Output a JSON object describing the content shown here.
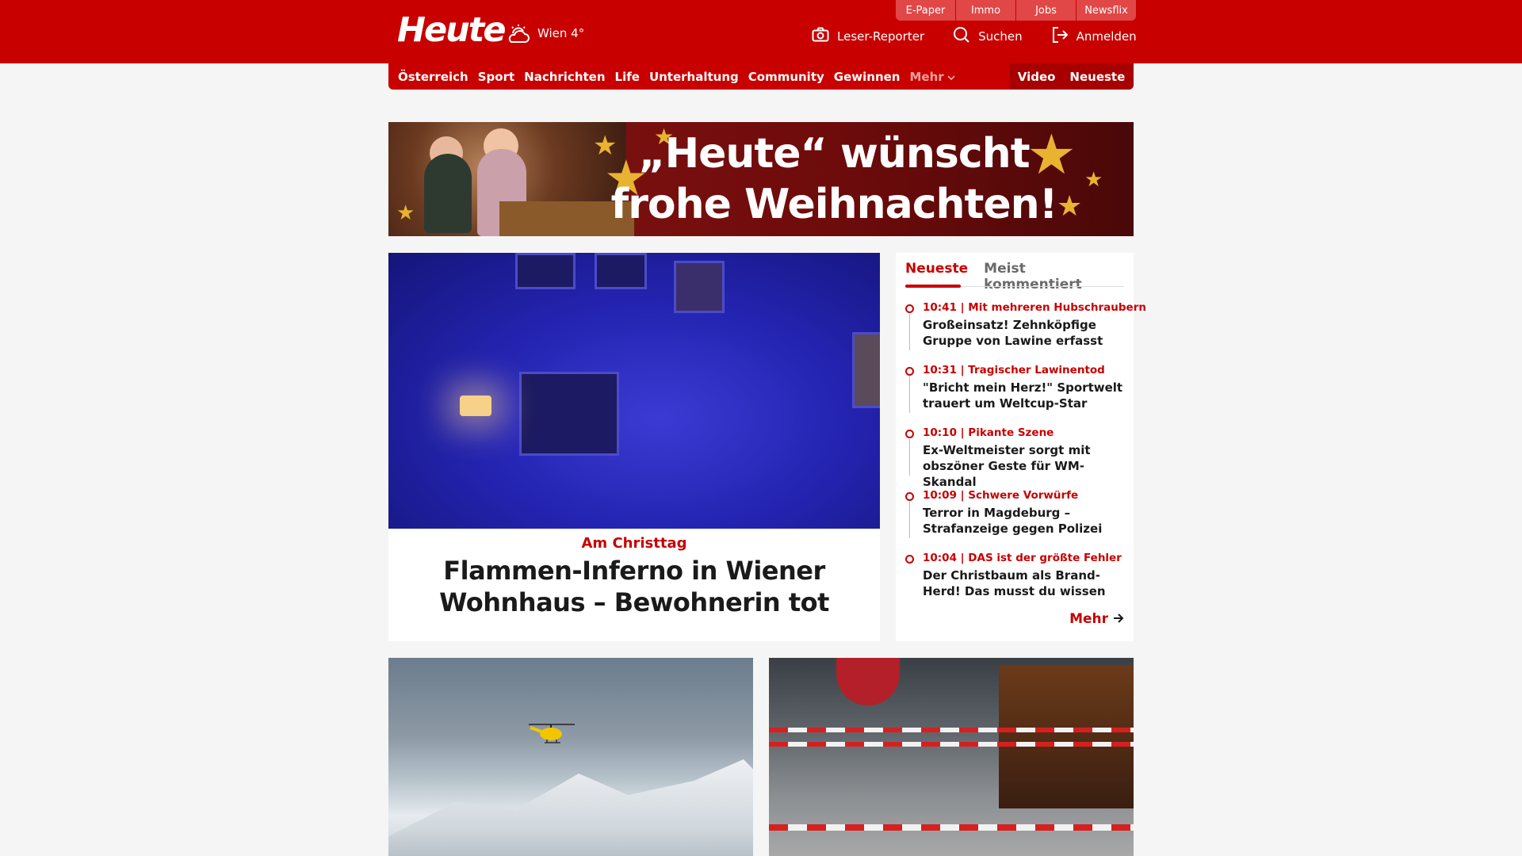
{
  "header": {
    "logo": "Heute",
    "weather": {
      "icon": "cloud-sun-icon",
      "text": "Wien 4°"
    },
    "services": [
      "E-Paper",
      "Immo",
      "Jobs",
      "Newsflix"
    ],
    "actions": [
      {
        "icon": "camera-icon",
        "label": "Leser-Reporter"
      },
      {
        "icon": "search-icon",
        "label": "Suchen"
      },
      {
        "icon": "login-icon",
        "label": "Anmelden"
      }
    ]
  },
  "nav": {
    "items": [
      "Österreich",
      "Sport",
      "Nachrichten",
      "Life",
      "Unterhaltung",
      "Community",
      "Gewinnen"
    ],
    "more": "Mehr",
    "right": [
      "Video",
      "Neueste"
    ]
  },
  "banner": {
    "line1": "„Heute“ wünscht",
    "line2": "frohe Weihnachten!"
  },
  "lead": {
    "kicker": "Am Christtag",
    "headline": "Flammen-Inferno in Wiener Wohnhaus – Bewohnerin tot"
  },
  "latest": {
    "tabs": [
      "Neueste",
      "Meist kommentiert"
    ],
    "items": [
      {
        "meta": "10:41 | Mit mehreren Hubschraubern",
        "title": "Großeinsatz! Zehnköpfige Gruppe von Lawine erfasst"
      },
      {
        "meta": "10:31 | Tragischer Lawinentod",
        "title": "\"Bricht mein Herz!\" Sportwelt trauert um Weltcup-Star"
      },
      {
        "meta": "10:10 | Pikante Szene",
        "title": "Ex-Weltmeister sorgt mit obszöner Geste für WM-Skandal"
      },
      {
        "meta": "10:09 | Schwere Vorwürfe",
        "title": "Terror in Magdeburg – Strafanzeige gegen Polizei"
      },
      {
        "meta": "10:04 | DAS ist der größte Fehler",
        "title": "Der Christbaum als Brand-Herd! Das musst du wissen"
      }
    ],
    "more": "Mehr"
  },
  "colors": {
    "brand": "#c80000",
    "background": "#f5f5f5"
  }
}
